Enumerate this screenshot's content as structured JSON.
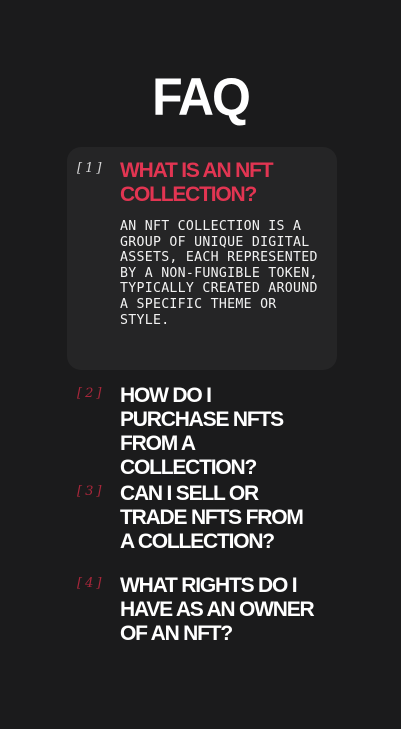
{
  "page": {
    "title": "FAQ"
  },
  "colors": {
    "background": "#1b1b1c",
    "card": "#252526",
    "accent": "#e23552",
    "number_accent": "#b8283e",
    "text": "#ffffff"
  },
  "faq": {
    "items": [
      {
        "number": "[1]",
        "question": "WHAT IS AN NFT COLLECTION?",
        "answer": "AN NFT COLLECTION IS A GROUP OF UNIQUE DIGITAL ASSETS, EACH REPRESENTED BY A NON-FUNGIBLE TOKEN, TYPICALLY CREATED AROUND A SPECIFIC THEME OR STYLE.",
        "expanded": true
      },
      {
        "number": "[2]",
        "question": "HOW DO I PURCHASE NFTS FROM A COLLECTION?",
        "expanded": false
      },
      {
        "number": "[3]",
        "question": "CAN I SELL OR TRADE NFTS FROM A COLLECTION?",
        "expanded": false
      },
      {
        "number": "[4]",
        "question": "WHAT RIGHTS DO I HAVE AS AN OWNER OF AN NFT?",
        "expanded": false
      }
    ]
  }
}
